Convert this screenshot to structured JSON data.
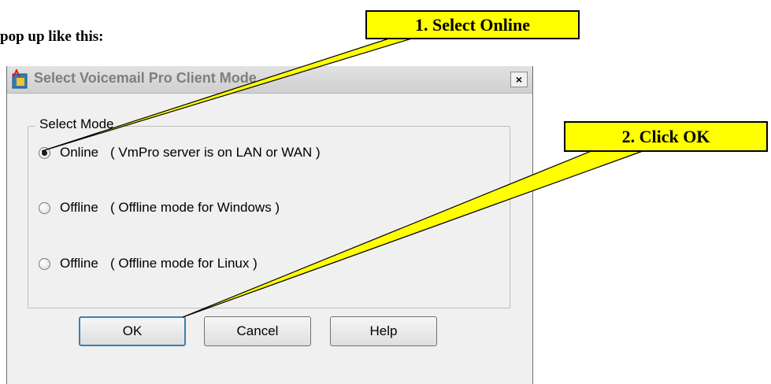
{
  "intro_text": "pop up like this:",
  "dialog": {
    "title": "Select Voicemail Pro Client Mode",
    "close_label": "×",
    "group_label": "Select Mode",
    "options": [
      {
        "mode": "Online",
        "description": "( VmPro server is on LAN or WAN )",
        "selected": true
      },
      {
        "mode": "Offline",
        "description": "( Offline mode for Windows )",
        "selected": false
      },
      {
        "mode": "Offline",
        "description": "( Offline mode for Linux )",
        "selected": false
      }
    ],
    "buttons": {
      "ok": "OK",
      "cancel": "Cancel",
      "help": "Help"
    }
  },
  "callouts": {
    "step1": "1. Select Online",
    "step2": "2. Click OK"
  },
  "colors": {
    "callout_fill": "#ffff00",
    "dialog_bg": "#f0f0f0"
  },
  "icons": {
    "app": "voicemail-pro-app-icon",
    "close": "close-icon",
    "radio": "radio-button-icon"
  }
}
